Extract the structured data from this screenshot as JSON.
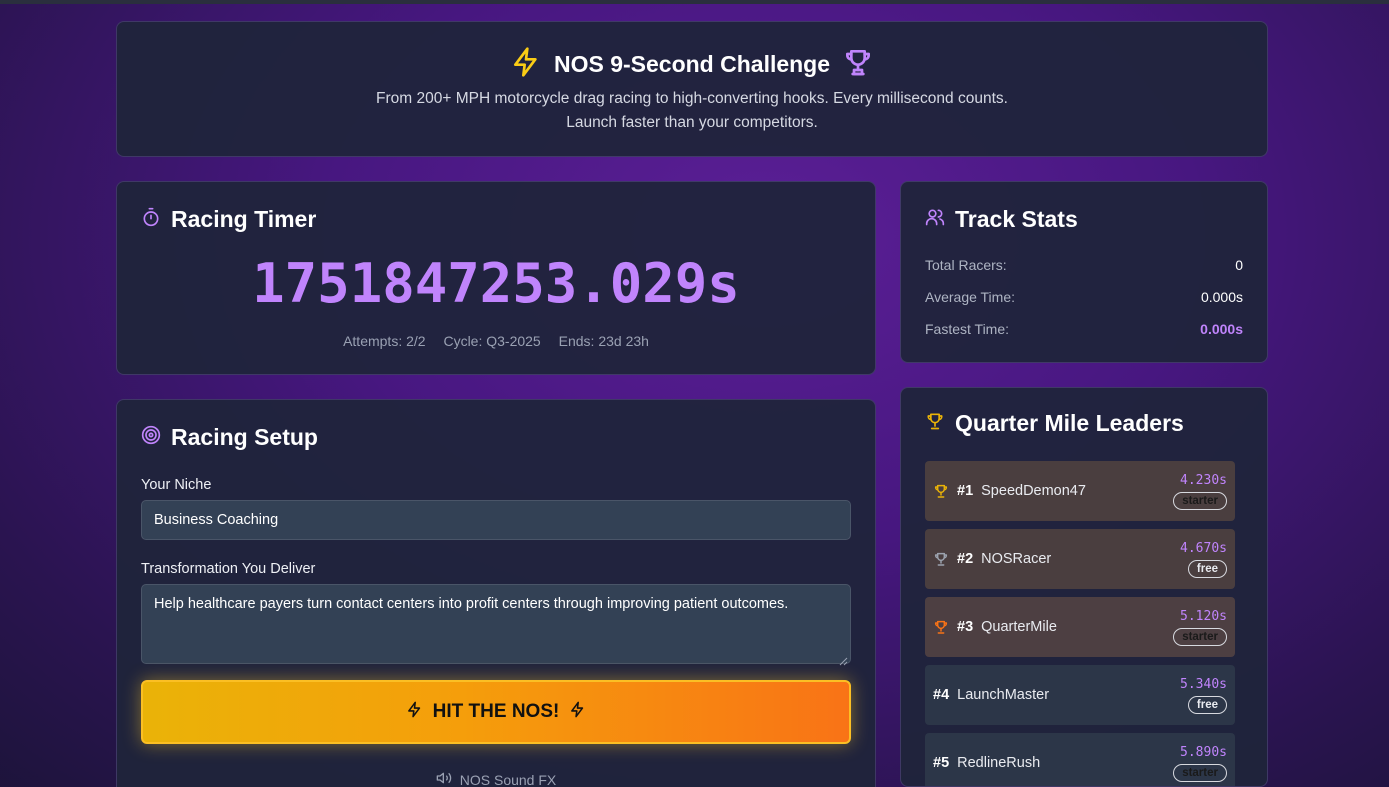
{
  "hero": {
    "title": "NOS 9-Second Challenge",
    "subtitle_line1": "From 200+ MPH motorcycle drag racing to high-converting hooks. Every millisecond counts.",
    "subtitle_line2": "Launch faster than your competitors.",
    "left_icon": "lightning-icon",
    "right_icon": "trophy-icon"
  },
  "timer": {
    "title": "Racing Timer",
    "icon": "stopwatch-icon",
    "value": "1751847253.029s",
    "attempts": "Attempts: 2/2",
    "cycle": "Cycle: Q3-2025",
    "ends": "Ends: 23d 23h"
  },
  "stats": {
    "title": "Track Stats",
    "icon": "users-icon",
    "rows": [
      {
        "label": "Total Racers:",
        "value": "0"
      },
      {
        "label": "Average Time:",
        "value": "0.000s"
      },
      {
        "label": "Fastest Time:",
        "value": "0.000s"
      }
    ]
  },
  "setup": {
    "title": "Racing Setup",
    "icon": "target-icon",
    "niche_label": "Your Niche",
    "niche_value": "Business Coaching",
    "transform_label": "Transformation You Deliver",
    "transform_value": "Help healthcare payers turn contact centers into profit centers through improving patient outcomes.",
    "button_label": "HIT THE NOS!",
    "sound_label": "NOS Sound FX"
  },
  "leaders": {
    "title": "Quarter Mile Leaders",
    "icon": "trophy-icon",
    "entries": [
      {
        "rank": "#1",
        "name": "SpeedDemon47",
        "time": "4.230s",
        "tier": "starter"
      },
      {
        "rank": "#2",
        "name": "NOSRacer",
        "time": "4.670s",
        "tier": "free"
      },
      {
        "rank": "#3",
        "name": "QuarterMile",
        "time": "5.120s",
        "tier": "starter"
      },
      {
        "rank": "#4",
        "name": "LaunchMaster",
        "time": "5.340s",
        "tier": "free"
      },
      {
        "rank": "#5",
        "name": "RedlineRush",
        "time": "5.890s",
        "tier": "starter"
      }
    ]
  },
  "colors": {
    "accent_purple": "#c084fc",
    "gold": "#eab308",
    "orange": "#f97316",
    "panel": "#1f243a"
  }
}
